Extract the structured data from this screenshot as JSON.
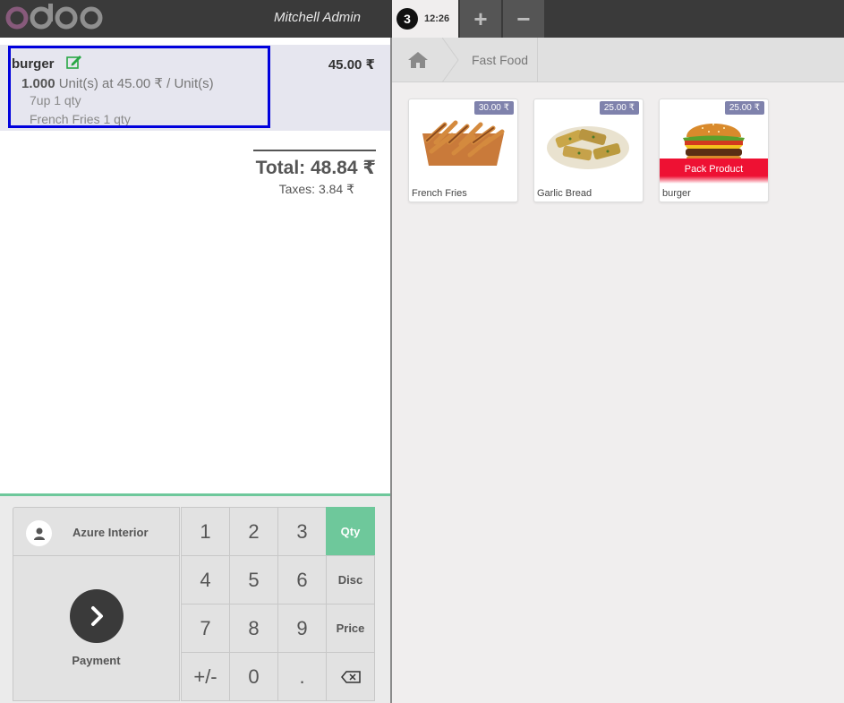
{
  "header": {
    "user_name": "Mitchell Admin",
    "order_number": "3",
    "order_time": "12:26",
    "add_order_label": "+",
    "remove_order_label": "−"
  },
  "order": {
    "line": {
      "name": "burger",
      "price": "45.00 ₹",
      "quantity": "1.000",
      "unit_text": "Unit(s) at 45.00 ₹ / Unit(s)",
      "combo_items": [
        "7up 1 qty",
        "French Fries 1 qty"
      ]
    },
    "total": "Total: 48.84 ₹",
    "taxes": "Taxes: 3.84 ₹"
  },
  "pad": {
    "customer": "Azure Interior",
    "payment": "Payment",
    "numbers": [
      "1",
      "2",
      "3",
      "4",
      "5",
      "6",
      "7",
      "8",
      "9",
      "+/-",
      "0",
      "."
    ],
    "modes": [
      "Qty",
      "Disc",
      "Price"
    ],
    "active_mode": "Qty"
  },
  "breadcrumb": {
    "category": "Fast Food"
  },
  "products": [
    {
      "name": "French Fries",
      "price": "30.00 ₹",
      "image": "french-fries"
    },
    {
      "name": "Garlic Bread",
      "price": "25.00 ₹",
      "image": "garlic-bread"
    },
    {
      "name": "burger",
      "price": "25.00 ₹",
      "image": "burger",
      "ribbon": "Pack Product"
    }
  ],
  "colors": {
    "accent": "#6ec89b",
    "price_tag": "#7f82ac",
    "ribbon": "#ee1133",
    "selection": "#0000dd"
  }
}
